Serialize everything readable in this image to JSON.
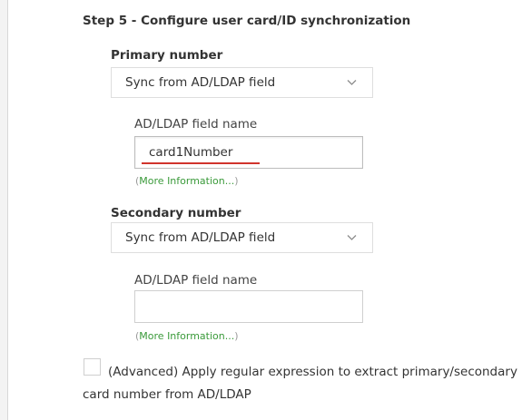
{
  "step": {
    "title": "Step 5 - Configure user card/ID synchronization"
  },
  "primary": {
    "label": "Primary number",
    "select_value": "Sync from AD/LDAP field",
    "chevron_icon": "chevron-down-icon",
    "field_label": "AD/LDAP field name",
    "field_value": "card1Number",
    "more_info_open": "(",
    "more_info_link": "More Information...",
    "more_info_close": ")"
  },
  "secondary": {
    "label": "Secondary number",
    "select_value": "Sync from AD/LDAP field",
    "chevron_icon": "chevron-down-icon",
    "field_label": "AD/LDAP field name",
    "field_value": "",
    "more_info_open": "(",
    "more_info_link": "More Information...",
    "more_info_close": ")"
  },
  "advanced": {
    "checked": false,
    "label": "(Advanced) Apply regular expression to extract primary/secondary card number from AD/LDAP"
  },
  "colors": {
    "link": "#3a9a3a",
    "spellcheck_underline": "#d0342c"
  }
}
